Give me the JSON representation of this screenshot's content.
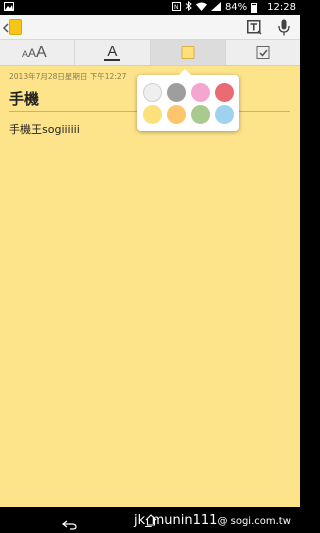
{
  "status_bar": {
    "battery": "84%",
    "time": "12:28"
  },
  "action_bar": {
    "back_icon": "chevron-left-icon",
    "app_icon": "memo-app-icon",
    "text_mode_icon": "text-mode-icon",
    "voice_icon": "microphone-icon"
  },
  "toolbar": {
    "items": [
      {
        "name": "font-size",
        "icon": "font-size-icon",
        "glyphs": [
          "A",
          "A",
          "A"
        ]
      },
      {
        "name": "font-color",
        "icon": "font-color-icon",
        "glyph": "A"
      },
      {
        "name": "background-color",
        "icon": "background-color-icon"
      },
      {
        "name": "checklist",
        "icon": "checkbox-icon"
      }
    ]
  },
  "note": {
    "date": "2013年7月28日星期日 下午12:27",
    "title": "手機",
    "body": "手機王sogiiiiii",
    "background_color": "#fde48a"
  },
  "palette": {
    "colors": [
      "#efefef",
      "#9e9e9e",
      "#f3a6d0",
      "#ea6b74",
      "#fce07c",
      "#ffc46e",
      "#a9c98e",
      "#9fd2ef"
    ]
  },
  "watermark": {
    "user": "jk_munin111",
    "domain": "@ sogi.com.tw"
  }
}
